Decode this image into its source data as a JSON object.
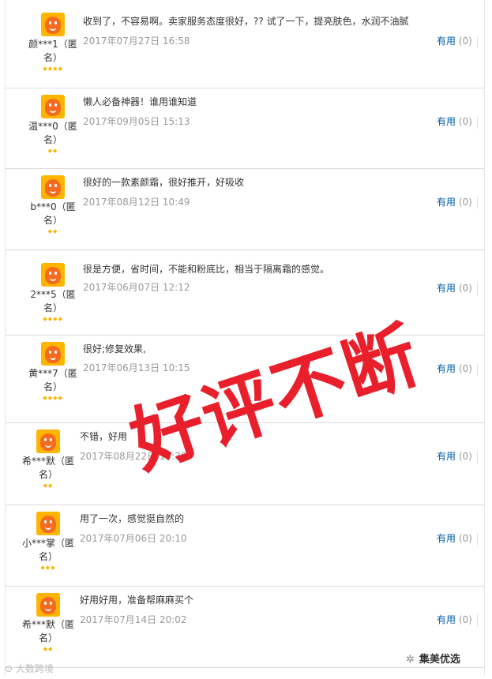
{
  "reviews": [
    {
      "user": "颜***1（匿名）",
      "stars": "◆◆◆◆",
      "content": "收到了，不容易啊。卖家服务态度很好，?? 试了一下，提亮肤色，水润不油腻",
      "time": "2017年07月27日 16:58",
      "useful_label": "有用",
      "useful_count": "(0)"
    },
    {
      "user": "温***0（匿名）",
      "stars": "◆◆",
      "content": "懒人必备神器！谁用谁知道",
      "time": "2017年09月05日 15:13",
      "useful_label": "有用",
      "useful_count": "(0)"
    },
    {
      "user": "b***0（匿名）",
      "stars": "◆◆",
      "content": "很好的一款素颜霜，很好推开，好吸收",
      "time": "2017年08月12日 10:49",
      "useful_label": "有用",
      "useful_count": "(0)"
    },
    {
      "user": "2***5（匿名）",
      "stars": "◆◆◆◆",
      "content": "很是方便，省时间，不能和粉底比，相当于隔离霜的感觉。",
      "time": "2017年06月07日 12:12",
      "useful_label": "有用",
      "useful_count": "(0)"
    },
    {
      "user": "黄***7（匿名）",
      "stars": "◆◆◆◆",
      "content": "很好;修复效果,",
      "time": "2017年06月13日 10:15",
      "useful_label": "有用",
      "useful_count": "(0)"
    },
    {
      "user": "希***默（匿名）",
      "stars": "◆◆",
      "content": "不错，好用",
      "time": "2017年08月22日 14:30",
      "useful_label": "有用",
      "useful_count": "(0)"
    },
    {
      "user": "小***掌（匿名）",
      "stars": "◆◆◆",
      "content": "用了一次，感觉挺自然的",
      "time": "2017年07月06日 20:10",
      "useful_label": "有用",
      "useful_count": "(0)"
    },
    {
      "user": "希***默（匿名）",
      "stars": "◆◆",
      "content": "好用好用，准备帮麻麻买个",
      "time": "2017年07月14日 20:02",
      "useful_label": "有用",
      "useful_count": "(0)"
    }
  ],
  "stamp": "好评不断",
  "watermark_left": "大数跨境",
  "watermark_right": "集美优选",
  "colors": {
    "accent": "#005ea7",
    "stamp": "#e8101c",
    "avatar_bg": "#ffb400"
  }
}
